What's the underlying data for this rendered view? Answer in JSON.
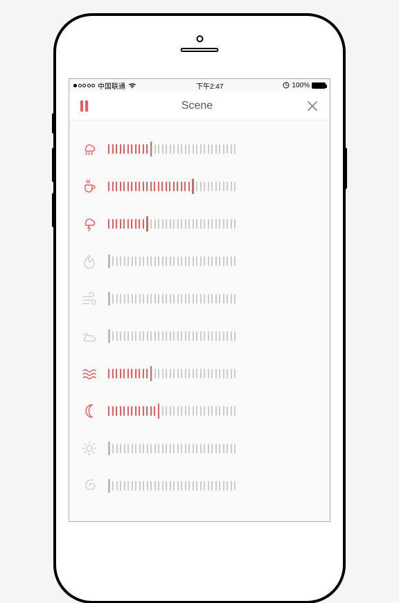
{
  "statusBar": {
    "carrier": "中国联通",
    "signalFilled": 1,
    "time": "下午2:47",
    "batteryPct": "100%",
    "orientationLock": "⊕"
  },
  "nav": {
    "title": "Scene"
  },
  "colors": {
    "accent": "#ec5a5a",
    "inactive": "#cccccc",
    "iconInactive": "#cfcfcf"
  },
  "slider": {
    "totalTicks": 34
  },
  "sounds": [
    {
      "id": "rain",
      "icon": "rain-icon",
      "value": 11,
      "active": true
    },
    {
      "id": "coffee",
      "icon": "cup-icon",
      "value": 22,
      "active": true
    },
    {
      "id": "thunder",
      "icon": "thunder-icon",
      "value": 10,
      "active": true
    },
    {
      "id": "fire",
      "icon": "fire-icon",
      "value": 0,
      "active": false
    },
    {
      "id": "wind",
      "icon": "wind-icon",
      "value": 0,
      "active": false
    },
    {
      "id": "clouds",
      "icon": "clouds-icon",
      "value": 0,
      "active": false
    },
    {
      "id": "waves",
      "icon": "waves-icon",
      "value": 11,
      "active": true
    },
    {
      "id": "night",
      "icon": "moon-icon",
      "value": 13,
      "active": true
    },
    {
      "id": "sun",
      "icon": "sun-icon",
      "value": 0,
      "active": false
    },
    {
      "id": "spiral",
      "icon": "spiral-icon",
      "value": 0,
      "active": false
    }
  ]
}
